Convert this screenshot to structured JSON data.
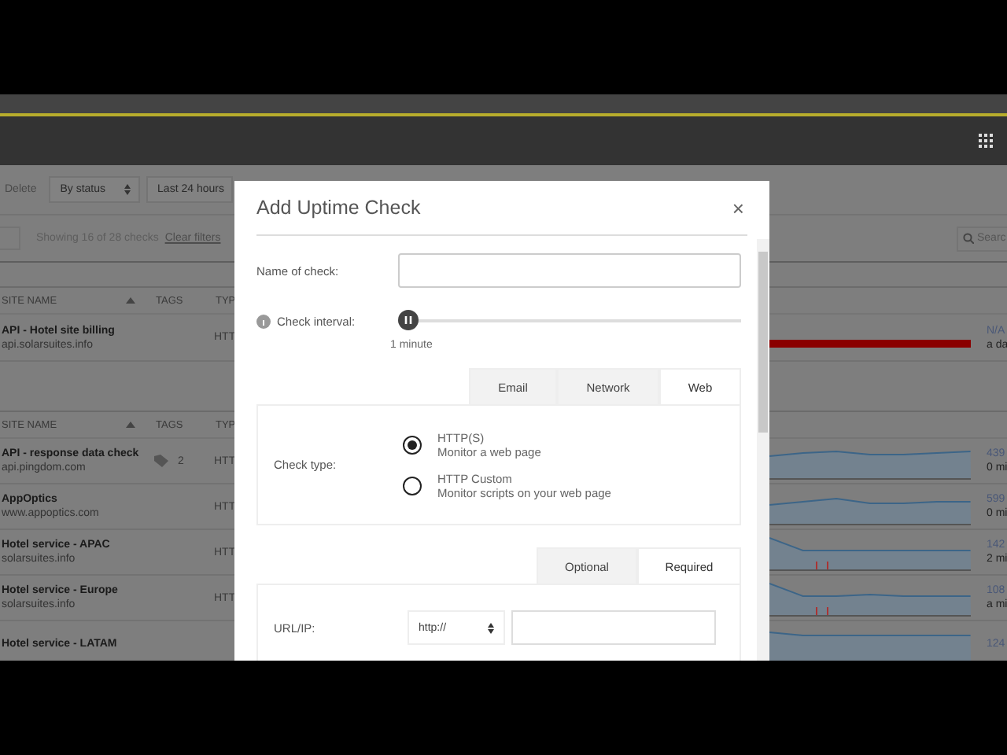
{
  "toolbar": {
    "delete": "Delete",
    "status_filter": "By status",
    "time_filter": "Last 24 hours",
    "search": {
      "placeholder": "Searc"
    }
  },
  "filter_summary": {
    "text": "Showing 16 of 28 checks",
    "link": "Clear filters"
  },
  "tables": [
    {
      "columns": [
        "SITE NAME",
        "TAGS",
        "TYP"
      ],
      "rows": [
        {
          "name": "API - Hotel site billing",
          "host": "api.solarsuites.info",
          "type": "HTT",
          "kind": "outage",
          "value": "N/A",
          "time": "a da"
        }
      ]
    },
    {
      "columns": [
        "SITE NAME",
        "TAGS",
        "TYP"
      ],
      "rows": [
        {
          "name": "API - response data check",
          "host": "api.pingdom.com",
          "tags": "2",
          "type": "HTT",
          "kind": "trend",
          "incidents": false,
          "value": "439",
          "time": "0 mi"
        },
        {
          "name": "AppOptics",
          "host": "www.appoptics.com",
          "type": "HTT",
          "kind": "trend",
          "incidents": false,
          "value": "599",
          "time": "0 mi"
        },
        {
          "name": "Hotel service - APAC",
          "host": "solarsuites.info",
          "type": "HTT",
          "kind": "trend",
          "incidents": true,
          "value": "142",
          "time": "2 mi"
        },
        {
          "name": "Hotel service - Europe",
          "host": "solarsuites.info",
          "type": "HTT",
          "kind": "trend",
          "incidents": true,
          "value": "108",
          "time": "a mi"
        },
        {
          "name": "Hotel service - LATAM",
          "kind": "trend",
          "incidents": false,
          "value": "124"
        }
      ]
    }
  ],
  "dialog": {
    "title": "Add Uptime Check",
    "close": "×",
    "name_field": {
      "label": "Name of check:"
    },
    "interval": {
      "label": "Check interval:",
      "level": 0,
      "reading": "1 minute"
    },
    "type_tabs": [
      {
        "label": "Email",
        "selected": false
      },
      {
        "label": "Network",
        "selected": false
      },
      {
        "label": "Web",
        "selected": true
      }
    ],
    "check_type": {
      "label": "Check type:",
      "options": [
        {
          "title": "HTTP(S)",
          "description": "Monitor a web page",
          "selected": true
        },
        {
          "title": "HTTP Custom",
          "description": "Monitor scripts on your web page",
          "selected": false
        }
      ]
    },
    "settings_tabs": [
      {
        "label": "Optional",
        "selected": false
      },
      {
        "label": "Required",
        "selected": true
      }
    ],
    "url_field": {
      "label": "URL/IP:",
      "protocol": "http://"
    }
  }
}
